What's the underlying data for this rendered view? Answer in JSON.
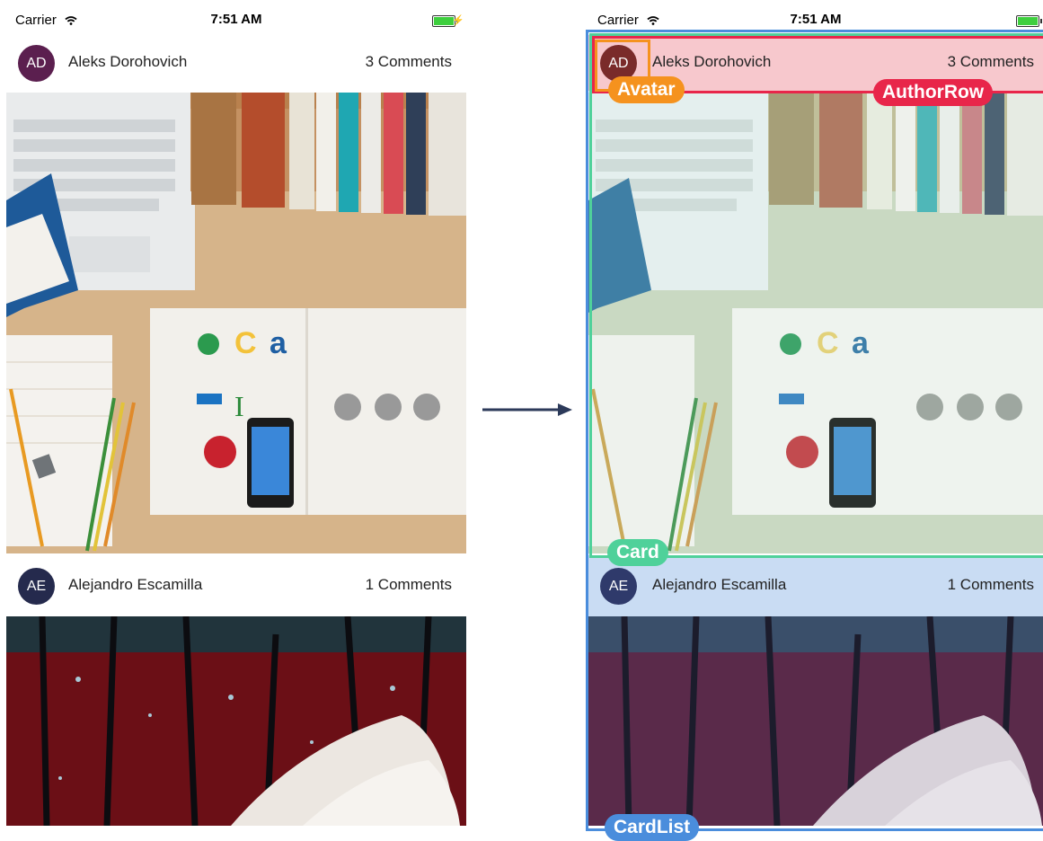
{
  "status_bar": {
    "carrier": "Carrier",
    "time": "7:51 AM"
  },
  "feed": [
    {
      "initials": "AD",
      "author": "Aleks Dorohovich",
      "comments": "3 Comments",
      "avatar_color": "#5b1f4f"
    },
    {
      "initials": "AE",
      "author": "Alejandro Escamilla",
      "comments": "1 Comments",
      "avatar_color": "#252a4d"
    }
  ],
  "annotated_feed": [
    {
      "initials": "AD",
      "author": "Aleks Dorohovich",
      "comments": "3 Comments",
      "avatar_color": "#7a2b2a"
    },
    {
      "initials": "AE",
      "author": "Alejandro Escamilla",
      "comments": "1 Comments",
      "avatar_color": "#2f3a6b"
    }
  ],
  "labels": {
    "avatar": "Avatar",
    "author_row": "AuthorRow",
    "card": "Card",
    "card_list": "CardList"
  },
  "colors": {
    "avatar": "#f5921e",
    "author_row": "#e8264a",
    "card": "#4fd19a",
    "card_list": "#4a8ddc"
  }
}
